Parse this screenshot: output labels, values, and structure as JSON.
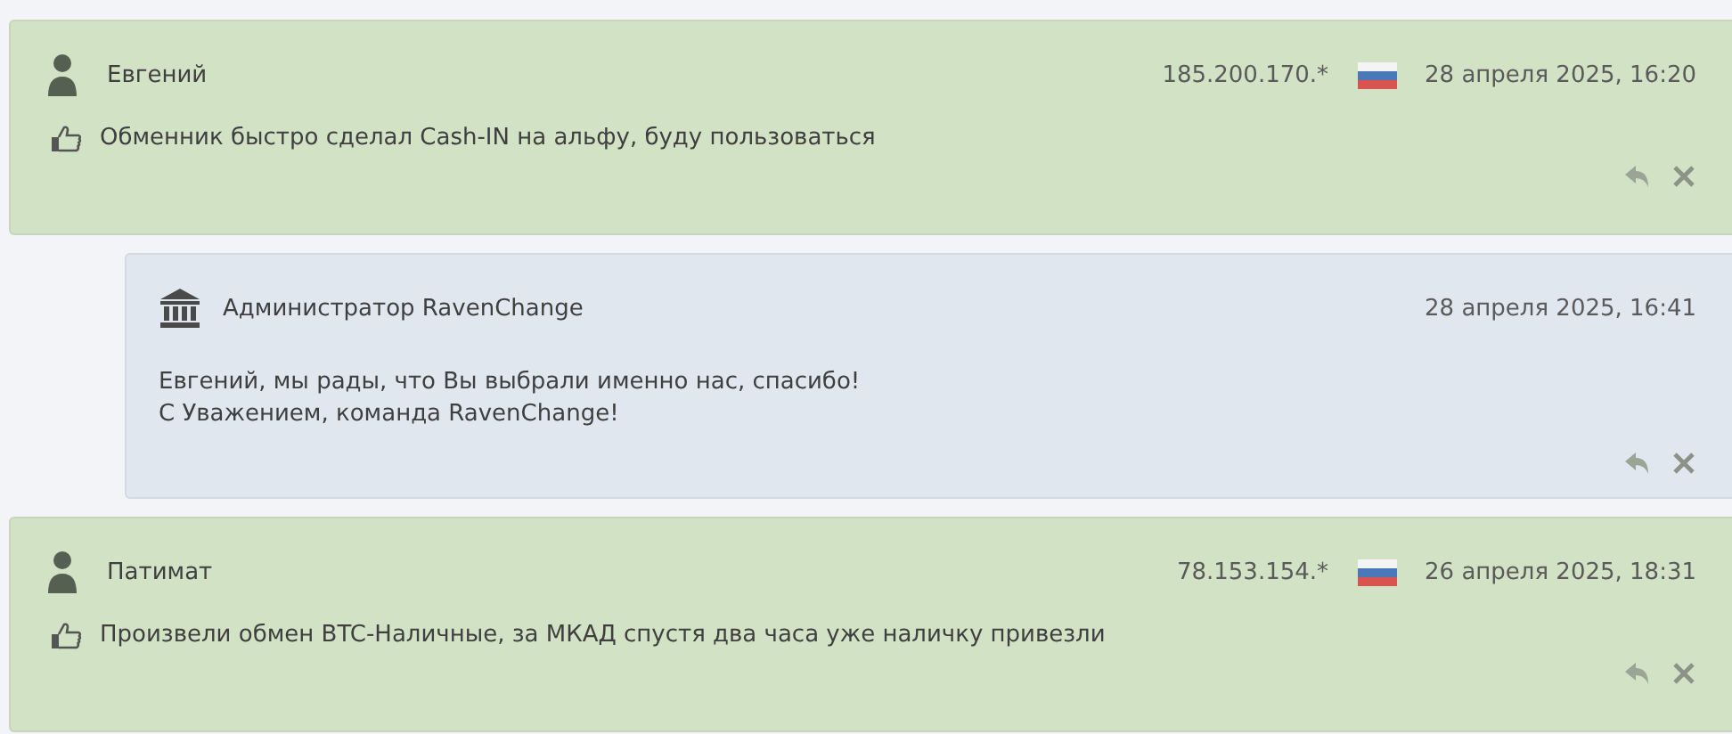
{
  "comments": [
    {
      "kind": "review",
      "author": "Евгений",
      "ip": "185.200.170.*",
      "has_flag": true,
      "date": "28 апреля 2025, 16:20",
      "lines": [
        "Обменник быстро сделал Cash-IN на альфу, буду пользоваться"
      ]
    },
    {
      "kind": "reply",
      "author": "Администратор RavenChange",
      "date": "28 апреля 2025, 16:41",
      "lines": [
        "Евгений, мы рады, что Вы выбрали именно нас, спасибо!",
        "С Уважением, команда RavenChange!"
      ]
    },
    {
      "kind": "review",
      "author": "Патимат",
      "ip": "78.153.154.*",
      "has_flag": true,
      "date": "26 апреля 2025, 18:31",
      "lines": [
        "Произвели обмен BTC-Наличные, за МКАД спустя два часа уже наличку привезли"
      ]
    }
  ]
}
